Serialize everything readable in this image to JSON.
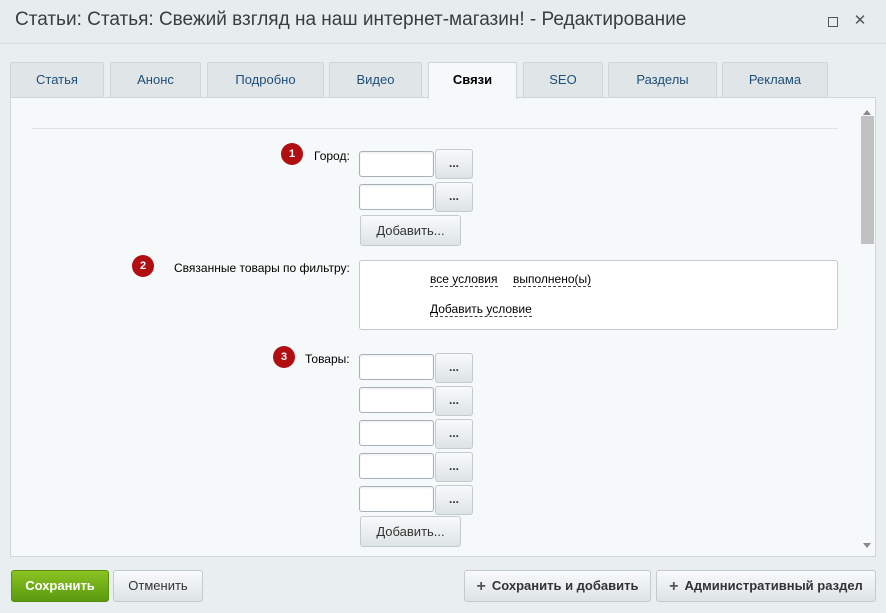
{
  "window": {
    "title": "Статьи: Статья: Свежий взгляд на наш интернет-магазин! - Редактирование",
    "maximize_icon": "maximize-icon",
    "close_icon": "close-icon",
    "close_glyph": "✕"
  },
  "tabs": [
    {
      "label": "Статья"
    },
    {
      "label": "Анонс"
    },
    {
      "label": "Подробно"
    },
    {
      "label": "Видео"
    },
    {
      "label": "Связи"
    },
    {
      "label": "SEO"
    },
    {
      "label": "Разделы"
    },
    {
      "label": "Реклама"
    }
  ],
  "active_tab": "Связи",
  "fields": {
    "city": {
      "badge": "1",
      "label": "Город:",
      "inputs": [
        "",
        ""
      ],
      "browse_label": "...",
      "add_label": "Добавить..."
    },
    "filter": {
      "badge": "2",
      "label": "Связанные товары по фильтру:",
      "condition_all": "все условия",
      "condition_done": "выполнено(ы)",
      "add_condition": "Добавить условие"
    },
    "products": {
      "badge": "3",
      "label": "Товары:",
      "inputs": [
        "",
        "",
        "",
        "",
        ""
      ],
      "browse_label": "...",
      "add_label": "Добавить..."
    }
  },
  "footer": {
    "save": "Сохранить",
    "cancel": "Отменить",
    "save_and_add": "Сохранить и добавить",
    "admin_section": "Административный раздел",
    "plus_glyph": "+"
  },
  "colors": {
    "accent_save": "#6aab16",
    "badge": "#b10e12",
    "tab_text": "#1e4e7a"
  }
}
